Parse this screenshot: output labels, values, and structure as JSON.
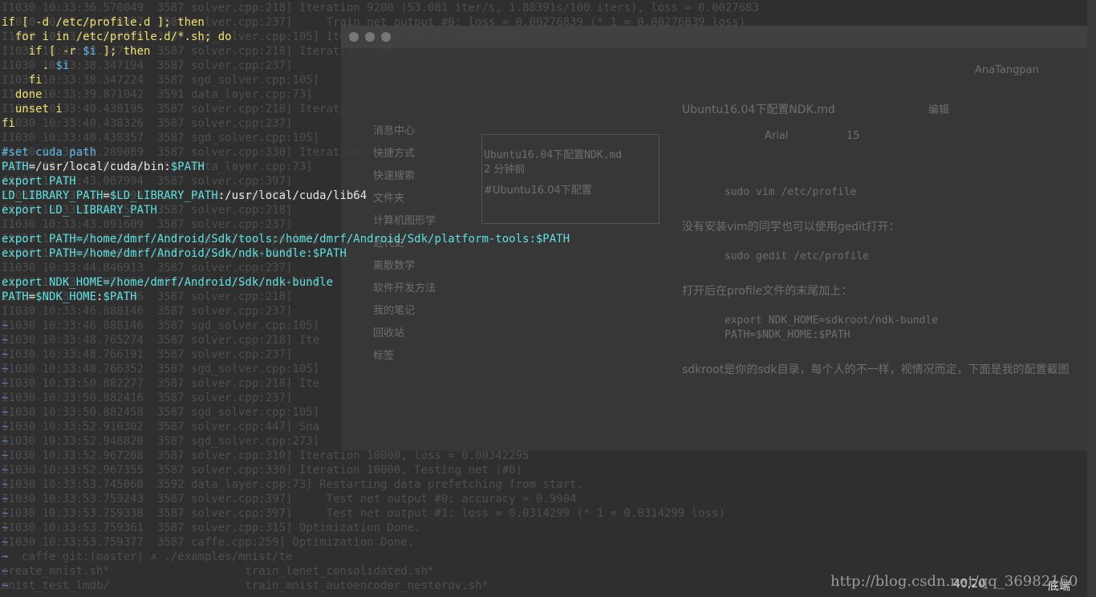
{
  "background_lines": [
    "I1030 10:33:36.570049  3587 solver.cpp:218] Iteration 9200 (53.081 iter/s, 1.88391s/100 iters), loss = 0.0027683",
    "I1030 10:33:36.570077  3587 solver.cpp:237]     Train net output #0: loss = 0.00276839 (* 1 = 0.00276839 loss)",
    "I1030 10:33:36.570083  3587 sgd_solver.cpp:105] Iteration 9200, lr = 0.00608",
    "I1030 10:33:38.347149  3587 solver.cpp:218] Iteration 9300",
    "I1030 10:33:38.347194  3587 solver.cpp:237]",
    "I1030 10:33:38.347224  3587 sgd_solver.cpp:105]",
    "I1030 10:33:39.871042  3591 data_layer.cpp:73]",
    "I1030 10:33:40.438195  3587 solver.cpp:218] Iteration",
    "I1030 10:33:40.438326  3587 solver.cpp:237]",
    "I1030 10:33:40.438357  3587 sgd_solver.cpp:105]",
    "I1030 10:33:42.289089  3587 solver.cpp:330] Iteration",
    "I1030 10:33:43.056494  3592 data_layer.cpp:73]",
    "I1030 10:33:43.067994  3587 solver.cpp:397]",
    "I1030 10:33:43.067994  3587 solver.cpp:397]",
    "I1030 10:33:43.091594  3587 solver.cpp:218]",
    "I1030 10:33:43.091609  3587 solver.cpp:237]",
    "I1030 10:33:43.091610  3587 sgd_solver.cpp:105]",
    "I1030 10:33:44.846913  3587 solver.cpp:218]",
    "I1030 10:33:44.846913  3587 solver.cpp:237]",
    "I1030 10:33:44.986913  3587 sgd_solver.cpp:105]",
    "I1030 10:33:46.888146  3587 solver.cpp:218]",
    "I1030 10:33:46.888146  3587 solver.cpp:237]",
    "I1030 10:33:46.888146  3587 sgd_solver.cpp:105]",
    "I1030 10:33:48.765274  3587 solver.cpp:218] Ite",
    "I1030 10:33:48.766191  3587 solver.cpp:237]",
    "I1030 10:33:48.766352  3587 sgd_solver.cpp:105]",
    "I1030 10:33:50.882277  3587 solver.cpp:218] Ite",
    "I1030 10:33:50.882416  3587 solver.cpp:237]",
    "I1030 10:33:50.882458  3587 sgd_solver.cpp:105]",
    "I1030 10:33:52.910302  3587 solver.cpp:447] Sna",
    "I1030 10:33:52.948820  3587 sgd_solver.cpp:273]",
    "I1030 10:33:52.967208  3587 solver.cpp:310] Iteration 10000, loss = 0.00342295",
    "I1030 10:33:52.967355  3587 solver.cpp:330] Iteration 10000, Testing net (#0)",
    "I1030 10:33:53.745060  3592 data_layer.cpp:73] Restarting data prefetching from start.",
    "I1030 10:33:53.759243  3587 solver.cpp:397]     Test net output #0: accuracy = 0.9904",
    "I1030 10:33:53.759338  3587 solver.cpp:397]     Test net output #1: loss = 0.0314299 (* 1 = 0.0314299 loss)",
    "I1030 10:33:53.759361  3587 solver.cpp:315] Optimization Done.",
    "I1030 10:33:53.759377  3587 caffe.cpp:259] Optimization Done.",
    "➜  caffe git:(master) ✗ ./examples/mnist/te",
    "create_mnist.sh*                    train_lenet_consolidated.sh*",
    "mnist_test_lmdb/                    train_mnist_autoencoder_nesterov.sh*"
  ],
  "editor_lines": [
    [
      {
        "t": "if [ -d /etc/profile.d ]; then",
        "c": "#f0e070"
      }
    ],
    [
      {
        "t": "  for i in /etc/profile.d/*.sh; do",
        "c": "#f0e070"
      }
    ],
    [
      {
        "t": "    if [ -r ",
        "c": "#f0e070"
      },
      {
        "t": "$i",
        "c": "#5fb6e8"
      },
      {
        "t": " ]; then",
        "c": "#f0e070"
      }
    ],
    [
      {
        "t": "      . ",
        "c": "#f0e070"
      },
      {
        "t": "$i",
        "c": "#5fb6e8"
      }
    ],
    [
      {
        "t": "    fi",
        "c": "#f0e070"
      }
    ],
    [
      {
        "t": "  done",
        "c": "#f0e070"
      }
    ],
    [
      {
        "t": "  unset i",
        "c": "#f0e070"
      }
    ],
    [
      {
        "t": "fi",
        "c": "#f0e070"
      }
    ],
    [],
    [
      {
        "t": "#set cuda path",
        "c": "#5fb6e8"
      }
    ],
    [
      {
        "t": "PATH",
        "c": "#5fe0e0"
      },
      {
        "t": "=/usr/local/cuda/bin:",
        "c": "#e8e8e8"
      },
      {
        "t": "$PATH",
        "c": "#5fe0e0"
      }
    ],
    [
      {
        "t": "export PATH",
        "c": "#5fe0e0"
      }
    ],
    [
      {
        "t": "LD_LIBRARY_PATH",
        "c": "#5fe0e0"
      },
      {
        "t": "=",
        "c": "#e8e8e8"
      },
      {
        "t": "$LD_LIBRARY_PATH",
        "c": "#5fe0e0"
      },
      {
        "t": ":/usr/local/cuda/lib64",
        "c": "#e8e8e8"
      }
    ],
    [
      {
        "t": "export LD_ LIBRARY_PATH",
        "c": "#5fe0e0"
      }
    ],
    [],
    [
      {
        "t": "export PATH=/home/dmrf/Android/Sdk/tools:/home/dmrf/Android/Sdk/platform-tools:",
        "c": "#5fe0e0"
      },
      {
        "t": "$PATH",
        "c": "#5fe0e0"
      }
    ],
    [
      {
        "t": "export PATH=/home/dmrf/Android/Sdk/ndk-bundle:",
        "c": "#5fe0e0"
      },
      {
        "t": "$PATH",
        "c": "#5fe0e0"
      }
    ],
    [],
    [
      {
        "t": "export NDK_HOME=/home/dmrf/Android/Sdk/ndk-bundle",
        "c": "#5fe0e0"
      }
    ],
    [
      {
        "t": "PATH",
        "c": "#5fe0e0"
      },
      {
        "t": "=",
        "c": "#e8e8e8"
      },
      {
        "t": "$NDK_HOME",
        "c": "#5fe0e0"
      },
      {
        "t": ":",
        "c": "#e8e8e8"
      },
      {
        "t": "$PATH",
        "c": "#5fe0e0"
      }
    ]
  ],
  "tilde_count": 19,
  "tilde_char": "~",
  "overlay": {
    "doc_title": "Ubuntu16.04下配置NDK.md",
    "sidebar_items": [
      "消息中心",
      "快捷方式",
      "快速搜索",
      "文件夹",
      "计算机图形学",
      "近代史",
      "离散数学",
      "软件开发方法",
      "我的笔记",
      "回收站",
      "标签"
    ],
    "note1_title": "Ubuntu16.04下配置NDK.md",
    "note1_sub": "2 分钟前",
    "note2_title": "#Ubuntu16.04下配置",
    "code1": "sudo vim /etc/profile",
    "para1": "没有安装vim的同学也可以使用gedit打开：",
    "code2": "sudo gedit /etc/profile",
    "para2": "打开后在profile文件的末尾加上：",
    "code3a": "export NDK_HOME=sdkroot/ndk-bundle",
    "code3b": "PATH=$NDK_HOME:$PATH",
    "para3": "sdkroot是你的sdk目录，每个人的不一样，视情况而定，下面是我的配置截图",
    "user": "AnaTangpan",
    "edit_label": "编辑",
    "font_name": "Arial",
    "font_size": "15"
  },
  "status": {
    "position": "40,20",
    "scroll": "底端"
  },
  "watermark": "http://blog.csdn.net/qq_36982160"
}
